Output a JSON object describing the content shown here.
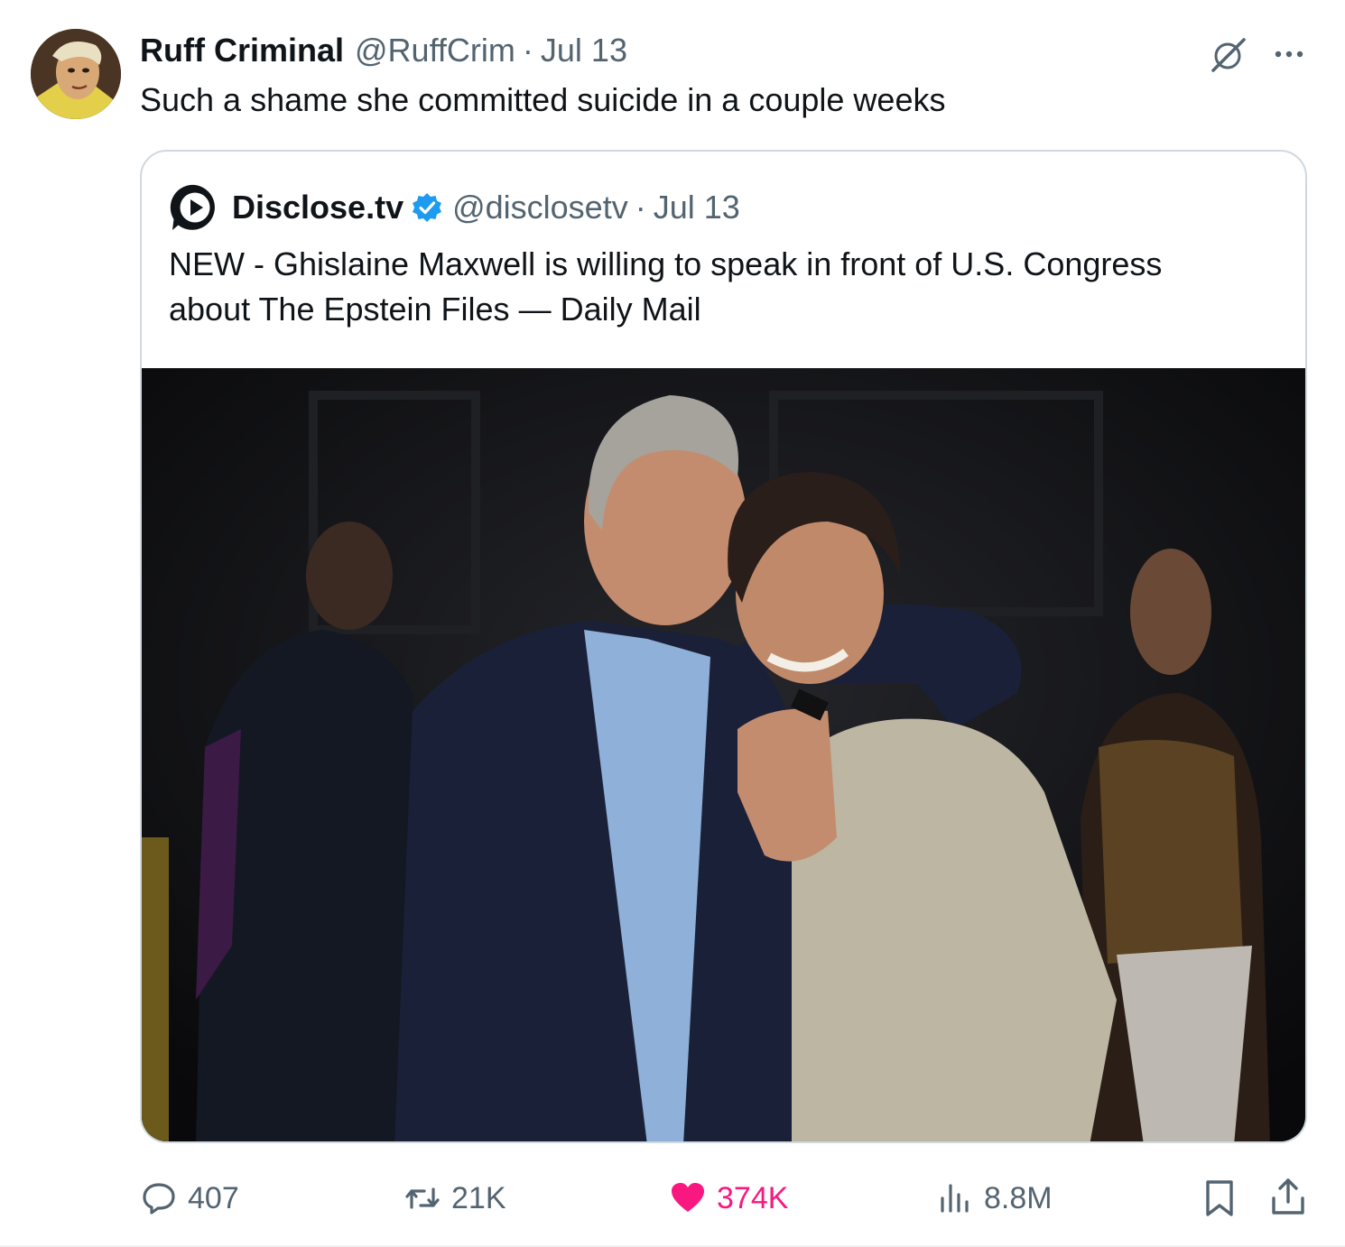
{
  "tweet": {
    "author_name": "Ruff Criminal",
    "author_handle": "@RuffCrim",
    "separator": "·",
    "date": "Jul 13",
    "text": "Such a shame she committed suicide in a couple weeks",
    "avatar_icon": "profile-photo-avatar",
    "grok_icon": "grok-icon",
    "more_icon": "more-options-icon"
  },
  "quote": {
    "author_name": "Disclose.tv",
    "author_handle": "@disclosetv",
    "separator": "·",
    "date": "Jul 13",
    "verified": true,
    "text_line1": "NEW - Ghislaine Maxwell is willing to speak in front of U.S. Congress",
    "text_line2": "about The Epstein Files — Daily Mail",
    "logo_icon": "disclose-play-logo",
    "media_icon": "photo-two-people-at-party"
  },
  "actions": {
    "replies": "407",
    "reposts": "21K",
    "likes": "374K",
    "views": "8.8M",
    "liked": true,
    "like_color": "#f91880",
    "muted_color": "#536471",
    "verified_color": "#1d9bf0"
  }
}
